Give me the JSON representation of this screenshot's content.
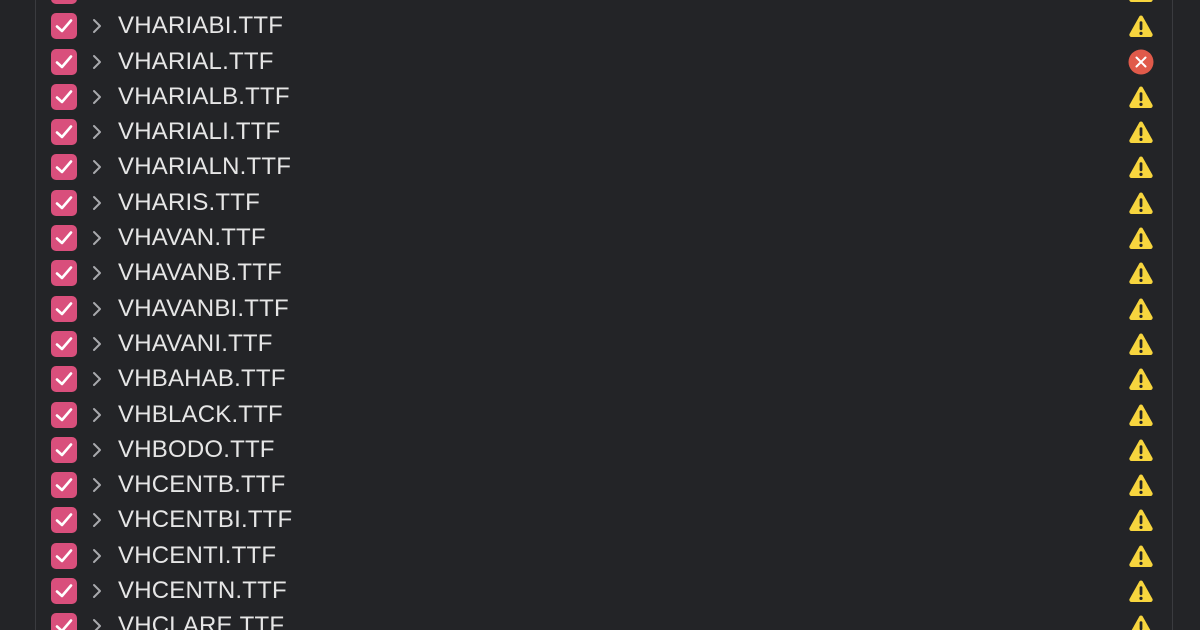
{
  "colors": {
    "background": "#232427",
    "checkbox_fill": "#d94f7c",
    "warning": "#f7d53e",
    "error": "#e05a4a",
    "text": "#e6e6e6"
  },
  "files": [
    {
      "name": "",
      "status": "warning-icon"
    },
    {
      "name": "VHARIABI.TTF",
      "status": "warning-icon"
    },
    {
      "name": "VHARIAL.TTF",
      "status": "error-icon"
    },
    {
      "name": "VHARIALB.TTF",
      "status": "warning-icon"
    },
    {
      "name": "VHARIALI.TTF",
      "status": "warning-icon"
    },
    {
      "name": "VHARIALN.TTF",
      "status": "warning-icon"
    },
    {
      "name": "VHARIS.TTF",
      "status": "warning-icon"
    },
    {
      "name": "VHAVAN.TTF",
      "status": "warning-icon"
    },
    {
      "name": "VHAVANB.TTF",
      "status": "warning-icon"
    },
    {
      "name": "VHAVANBI.TTF",
      "status": "warning-icon"
    },
    {
      "name": "VHAVANI.TTF",
      "status": "warning-icon"
    },
    {
      "name": "VHBAHAB.TTF",
      "status": "warning-icon"
    },
    {
      "name": "VHBLACK.TTF",
      "status": "warning-icon"
    },
    {
      "name": "VHBODO.TTF",
      "status": "warning-icon"
    },
    {
      "name": "VHCENTB.TTF",
      "status": "warning-icon"
    },
    {
      "name": "VHCENTBI.TTF",
      "status": "warning-icon"
    },
    {
      "name": "VHCENTI.TTF",
      "status": "warning-icon"
    },
    {
      "name": "VHCENTN.TTF",
      "status": "warning-icon"
    },
    {
      "name": "VHCLARE.TTF",
      "status": "warning-icon"
    }
  ]
}
